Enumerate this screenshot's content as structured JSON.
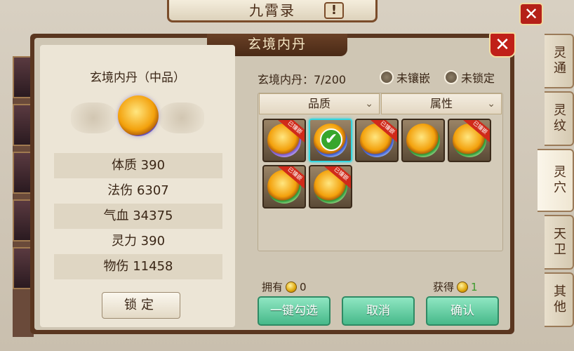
{
  "background": {
    "title": "九霄录",
    "help": "!",
    "close": "✕"
  },
  "side_tabs": [
    "灵通",
    "灵纹",
    "灵穴",
    "天卫",
    "其他"
  ],
  "side_tab_active": "灵穴",
  "dialog": {
    "title": "玄境内丹",
    "close": "✕"
  },
  "left": {
    "item_name": "玄境内丹（中品）",
    "stats": [
      "体质 390",
      "法伤 6307",
      "气血 34375",
      "灵力 390",
      "物伤 11458"
    ],
    "lock_button": "锁定"
  },
  "right": {
    "count_label": "玄境内丹：7/200",
    "filter_unembedded": "未镶嵌",
    "filter_unlocked": "未锁定",
    "sort_quality": "品质",
    "sort_attribute": "属性",
    "embedded_badge": "已镶嵌",
    "items": [
      {
        "color": "purple",
        "embedded": true,
        "selected": false
      },
      {
        "color": "blue",
        "embedded": false,
        "selected": true
      },
      {
        "color": "blue",
        "embedded": true,
        "selected": false
      },
      {
        "color": "green",
        "embedded": false,
        "selected": false
      },
      {
        "color": "green",
        "embedded": true,
        "selected": false
      },
      {
        "color": "green",
        "embedded": true,
        "selected": false
      },
      {
        "color": "green",
        "embedded": true,
        "selected": false
      }
    ],
    "owned_label": "拥有",
    "owned_value": "0",
    "gained_label": "获得",
    "gained_value": "1",
    "btn_select_all": "一键勾选",
    "btn_cancel": "取消",
    "btn_confirm": "确认"
  }
}
